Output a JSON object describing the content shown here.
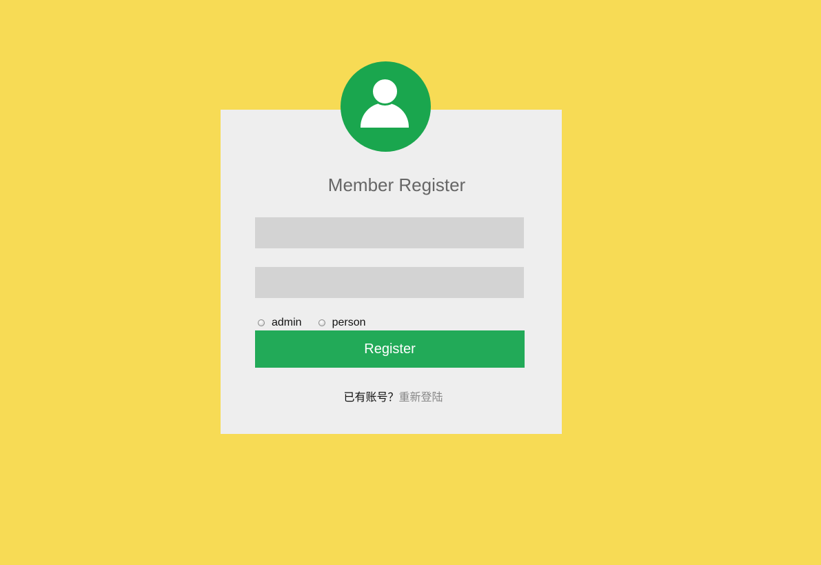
{
  "page": {
    "background_color": "#f7db55",
    "card_color": "#eeeeee",
    "accent_color": "#1aa64e",
    "button_color": "#22aa58"
  },
  "avatar": {
    "icon": "user-icon"
  },
  "form": {
    "title": "Member Register",
    "username": {
      "value": "",
      "placeholder": ""
    },
    "password": {
      "value": "",
      "placeholder": ""
    },
    "roles": [
      {
        "label": "admin",
        "checked": false
      },
      {
        "label": "person",
        "checked": false
      }
    ],
    "register_label": "Register"
  },
  "footer": {
    "prompt": "已有账号？",
    "link_label": "重新登陆"
  }
}
